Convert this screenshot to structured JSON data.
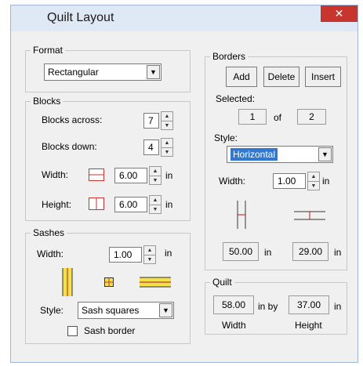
{
  "window": {
    "title": "Quilt Layout",
    "close_glyph": "✕"
  },
  "format": {
    "legend": "Format",
    "selected": "Rectangular"
  },
  "blocks": {
    "legend": "Blocks",
    "across_label": "Blocks across:",
    "across_value": "7",
    "down_label": "Blocks down:",
    "down_value": "4",
    "width_label": "Width:",
    "width_value": "6.00",
    "width_unit": "in",
    "height_label": "Height:",
    "height_value": "6.00",
    "height_unit": "in"
  },
  "sashes": {
    "legend": "Sashes",
    "width_label": "Width:",
    "width_value": "1.00",
    "width_unit": "in",
    "style_label": "Style:",
    "style_selected": "Sash squares",
    "border_label": "Sash border",
    "border_checked": false
  },
  "borders": {
    "legend": "Borders",
    "add_label": "Add",
    "delete_label": "Delete",
    "insert_label": "Insert",
    "selected_label": "Selected:",
    "selected_index": "1",
    "of_label": "of",
    "total": "2",
    "style_label": "Style:",
    "style_selected": "Horizontal",
    "width_label": "Width:",
    "width_value": "1.00",
    "width_unit": "in",
    "vertical_value": "50.00",
    "vertical_unit": "in",
    "horizontal_value": "29.00",
    "horizontal_unit": "in"
  },
  "quilt": {
    "legend": "Quilt",
    "width_value": "58.00",
    "by_label": "in by",
    "height_value": "37.00",
    "height_unit": "in",
    "width_caption": "Width",
    "height_caption": "Height"
  },
  "colors": {
    "accent_red": "#c7352f",
    "sash_yellow": "#f2e24a",
    "selection_blue": "#3078d0"
  }
}
